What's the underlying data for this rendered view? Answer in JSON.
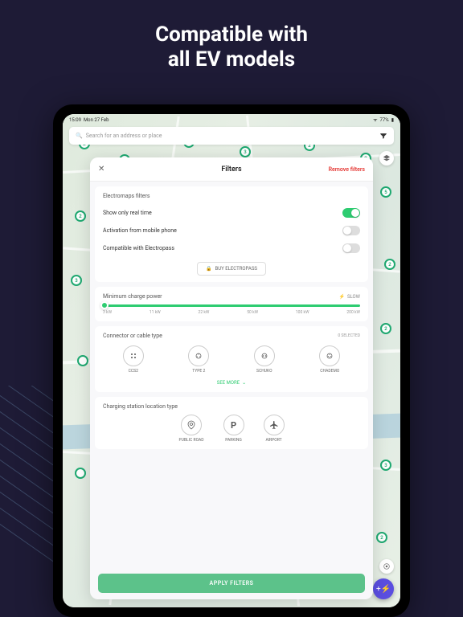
{
  "headline": "Compatible with\nall EV models",
  "status": {
    "time": "15:09",
    "date": "Mon 27 Feb",
    "battery": "77%"
  },
  "search": {
    "placeholder": "Search for an address or place"
  },
  "modal": {
    "title": "Filters",
    "close_label": "✕",
    "remove_label": "Remove filters",
    "sections": {
      "electromaps": {
        "title": "Electromaps filters",
        "items": [
          {
            "label": "Show only real time",
            "on": true
          },
          {
            "label": "Activation from mobile phone",
            "on": false
          },
          {
            "label": "Compatible with Electropass",
            "on": false
          }
        ],
        "buy_label": "BUY ELECTROPASS"
      },
      "power": {
        "title": "Minimum charge power",
        "tag": "SLOW",
        "ticks": [
          "3 kW",
          "11 kW",
          "22 kW",
          "50 kW",
          "100 kW",
          "200 kW"
        ]
      },
      "connector": {
        "title": "Connector or cable type",
        "count": "0 SELECTED",
        "items": [
          {
            "name": "CCS2"
          },
          {
            "name": "TYPE 2"
          },
          {
            "name": "SCHUKO"
          },
          {
            "name": "CHADEMO"
          }
        ],
        "see_more": "SEE MORE"
      },
      "location": {
        "title": "Charging station location type",
        "items": [
          {
            "name": "PUBLIC ROAD"
          },
          {
            "name": "PARKING"
          },
          {
            "name": "AIRPORT"
          }
        ]
      }
    },
    "apply_label": "APPLY FILTERS"
  },
  "pins": [
    "2",
    "3",
    "2",
    "3",
    "2",
    "2",
    "5",
    "2",
    "3",
    "2",
    "",
    "2",
    "3",
    "",
    "2",
    "2"
  ]
}
